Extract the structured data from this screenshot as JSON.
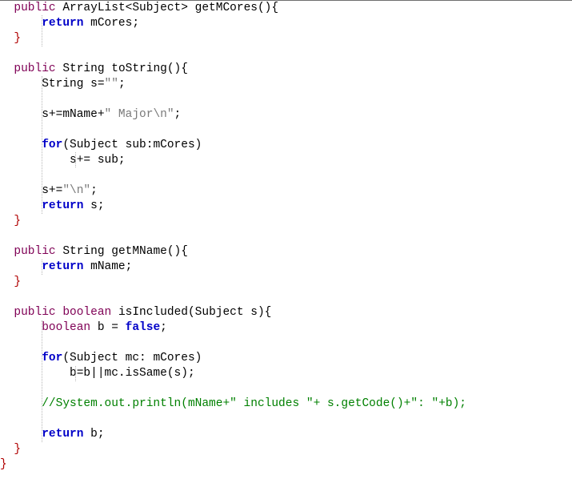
{
  "editor": {
    "lines": [
      {
        "segments": [
          {
            "text": "  public ",
            "cls": "kw-purple"
          },
          {
            "text": "ArrayList<Subject> getMCores(){",
            "cls": "plain"
          }
        ]
      },
      {
        "segments": [
          {
            "text": "      return ",
            "cls": "kw-blue"
          },
          {
            "text": "mCores;",
            "cls": "plain"
          }
        ]
      },
      {
        "segments": [
          {
            "text": "  }",
            "cls": "brace-red"
          }
        ]
      },
      {
        "segments": [
          {
            "text": "",
            "cls": "plain"
          }
        ]
      },
      {
        "segments": [
          {
            "text": "  public ",
            "cls": "kw-purple"
          },
          {
            "text": "String toString(){",
            "cls": "plain"
          }
        ]
      },
      {
        "segments": [
          {
            "text": "      String s=",
            "cls": "plain"
          },
          {
            "text": "\"\"",
            "cls": "str-gray"
          },
          {
            "text": ";",
            "cls": "plain"
          }
        ]
      },
      {
        "segments": [
          {
            "text": "",
            "cls": "plain"
          }
        ]
      },
      {
        "segments": [
          {
            "text": "      s+=mName+",
            "cls": "plain"
          },
          {
            "text": "\" Major\\n\"",
            "cls": "str-gray"
          },
          {
            "text": ";",
            "cls": "plain"
          }
        ]
      },
      {
        "segments": [
          {
            "text": "",
            "cls": "plain"
          }
        ]
      },
      {
        "segments": [
          {
            "text": "      for",
            "cls": "kw-blue"
          },
          {
            "text": "(Subject sub:mCores)",
            "cls": "plain"
          }
        ]
      },
      {
        "segments": [
          {
            "text": "          s+= sub;",
            "cls": "plain"
          }
        ]
      },
      {
        "segments": [
          {
            "text": "",
            "cls": "plain"
          }
        ]
      },
      {
        "segments": [
          {
            "text": "      s+=",
            "cls": "plain"
          },
          {
            "text": "\"\\n\"",
            "cls": "str-gray"
          },
          {
            "text": ";",
            "cls": "plain"
          }
        ]
      },
      {
        "segments": [
          {
            "text": "      return ",
            "cls": "kw-blue"
          },
          {
            "text": "s;",
            "cls": "plain"
          }
        ]
      },
      {
        "segments": [
          {
            "text": "  }",
            "cls": "brace-red"
          }
        ]
      },
      {
        "segments": [
          {
            "text": "",
            "cls": "plain"
          }
        ]
      },
      {
        "segments": [
          {
            "text": "  public ",
            "cls": "kw-purple"
          },
          {
            "text": "String getMName(){",
            "cls": "plain"
          }
        ]
      },
      {
        "segments": [
          {
            "text": "      return ",
            "cls": "kw-blue"
          },
          {
            "text": "mName;",
            "cls": "plain"
          }
        ]
      },
      {
        "segments": [
          {
            "text": "  }",
            "cls": "brace-red"
          }
        ]
      },
      {
        "segments": [
          {
            "text": "",
            "cls": "plain"
          }
        ]
      },
      {
        "segments": [
          {
            "text": "  public ",
            "cls": "kw-purple"
          },
          {
            "text": "boolean ",
            "cls": "kw-purple"
          },
          {
            "text": "isIncluded(Subject s){",
            "cls": "plain"
          }
        ]
      },
      {
        "segments": [
          {
            "text": "      boolean ",
            "cls": "kw-purple"
          },
          {
            "text": "b = ",
            "cls": "plain"
          },
          {
            "text": "false",
            "cls": "kw-blue"
          },
          {
            "text": ";",
            "cls": "plain"
          }
        ]
      },
      {
        "segments": [
          {
            "text": "",
            "cls": "plain"
          }
        ]
      },
      {
        "segments": [
          {
            "text": "      for",
            "cls": "kw-blue"
          },
          {
            "text": "(Subject mc: mCores)",
            "cls": "plain"
          }
        ]
      },
      {
        "segments": [
          {
            "text": "          b=b||mc.isSame(s);",
            "cls": "plain"
          }
        ]
      },
      {
        "segments": [
          {
            "text": "",
            "cls": "plain"
          }
        ]
      },
      {
        "segments": [
          {
            "text": "      //System.out.println(mName+\" includes \"+ s.getCode()+\": \"+b);",
            "cls": "comment-green"
          }
        ]
      },
      {
        "segments": [
          {
            "text": "",
            "cls": "plain"
          }
        ]
      },
      {
        "segments": [
          {
            "text": "      return ",
            "cls": "kw-blue"
          },
          {
            "text": "b;",
            "cls": "plain"
          }
        ]
      },
      {
        "segments": [
          {
            "text": "  }",
            "cls": "brace-red"
          }
        ]
      },
      {
        "segments": [
          {
            "text": "}",
            "cls": "brace-red"
          }
        ]
      }
    ]
  }
}
